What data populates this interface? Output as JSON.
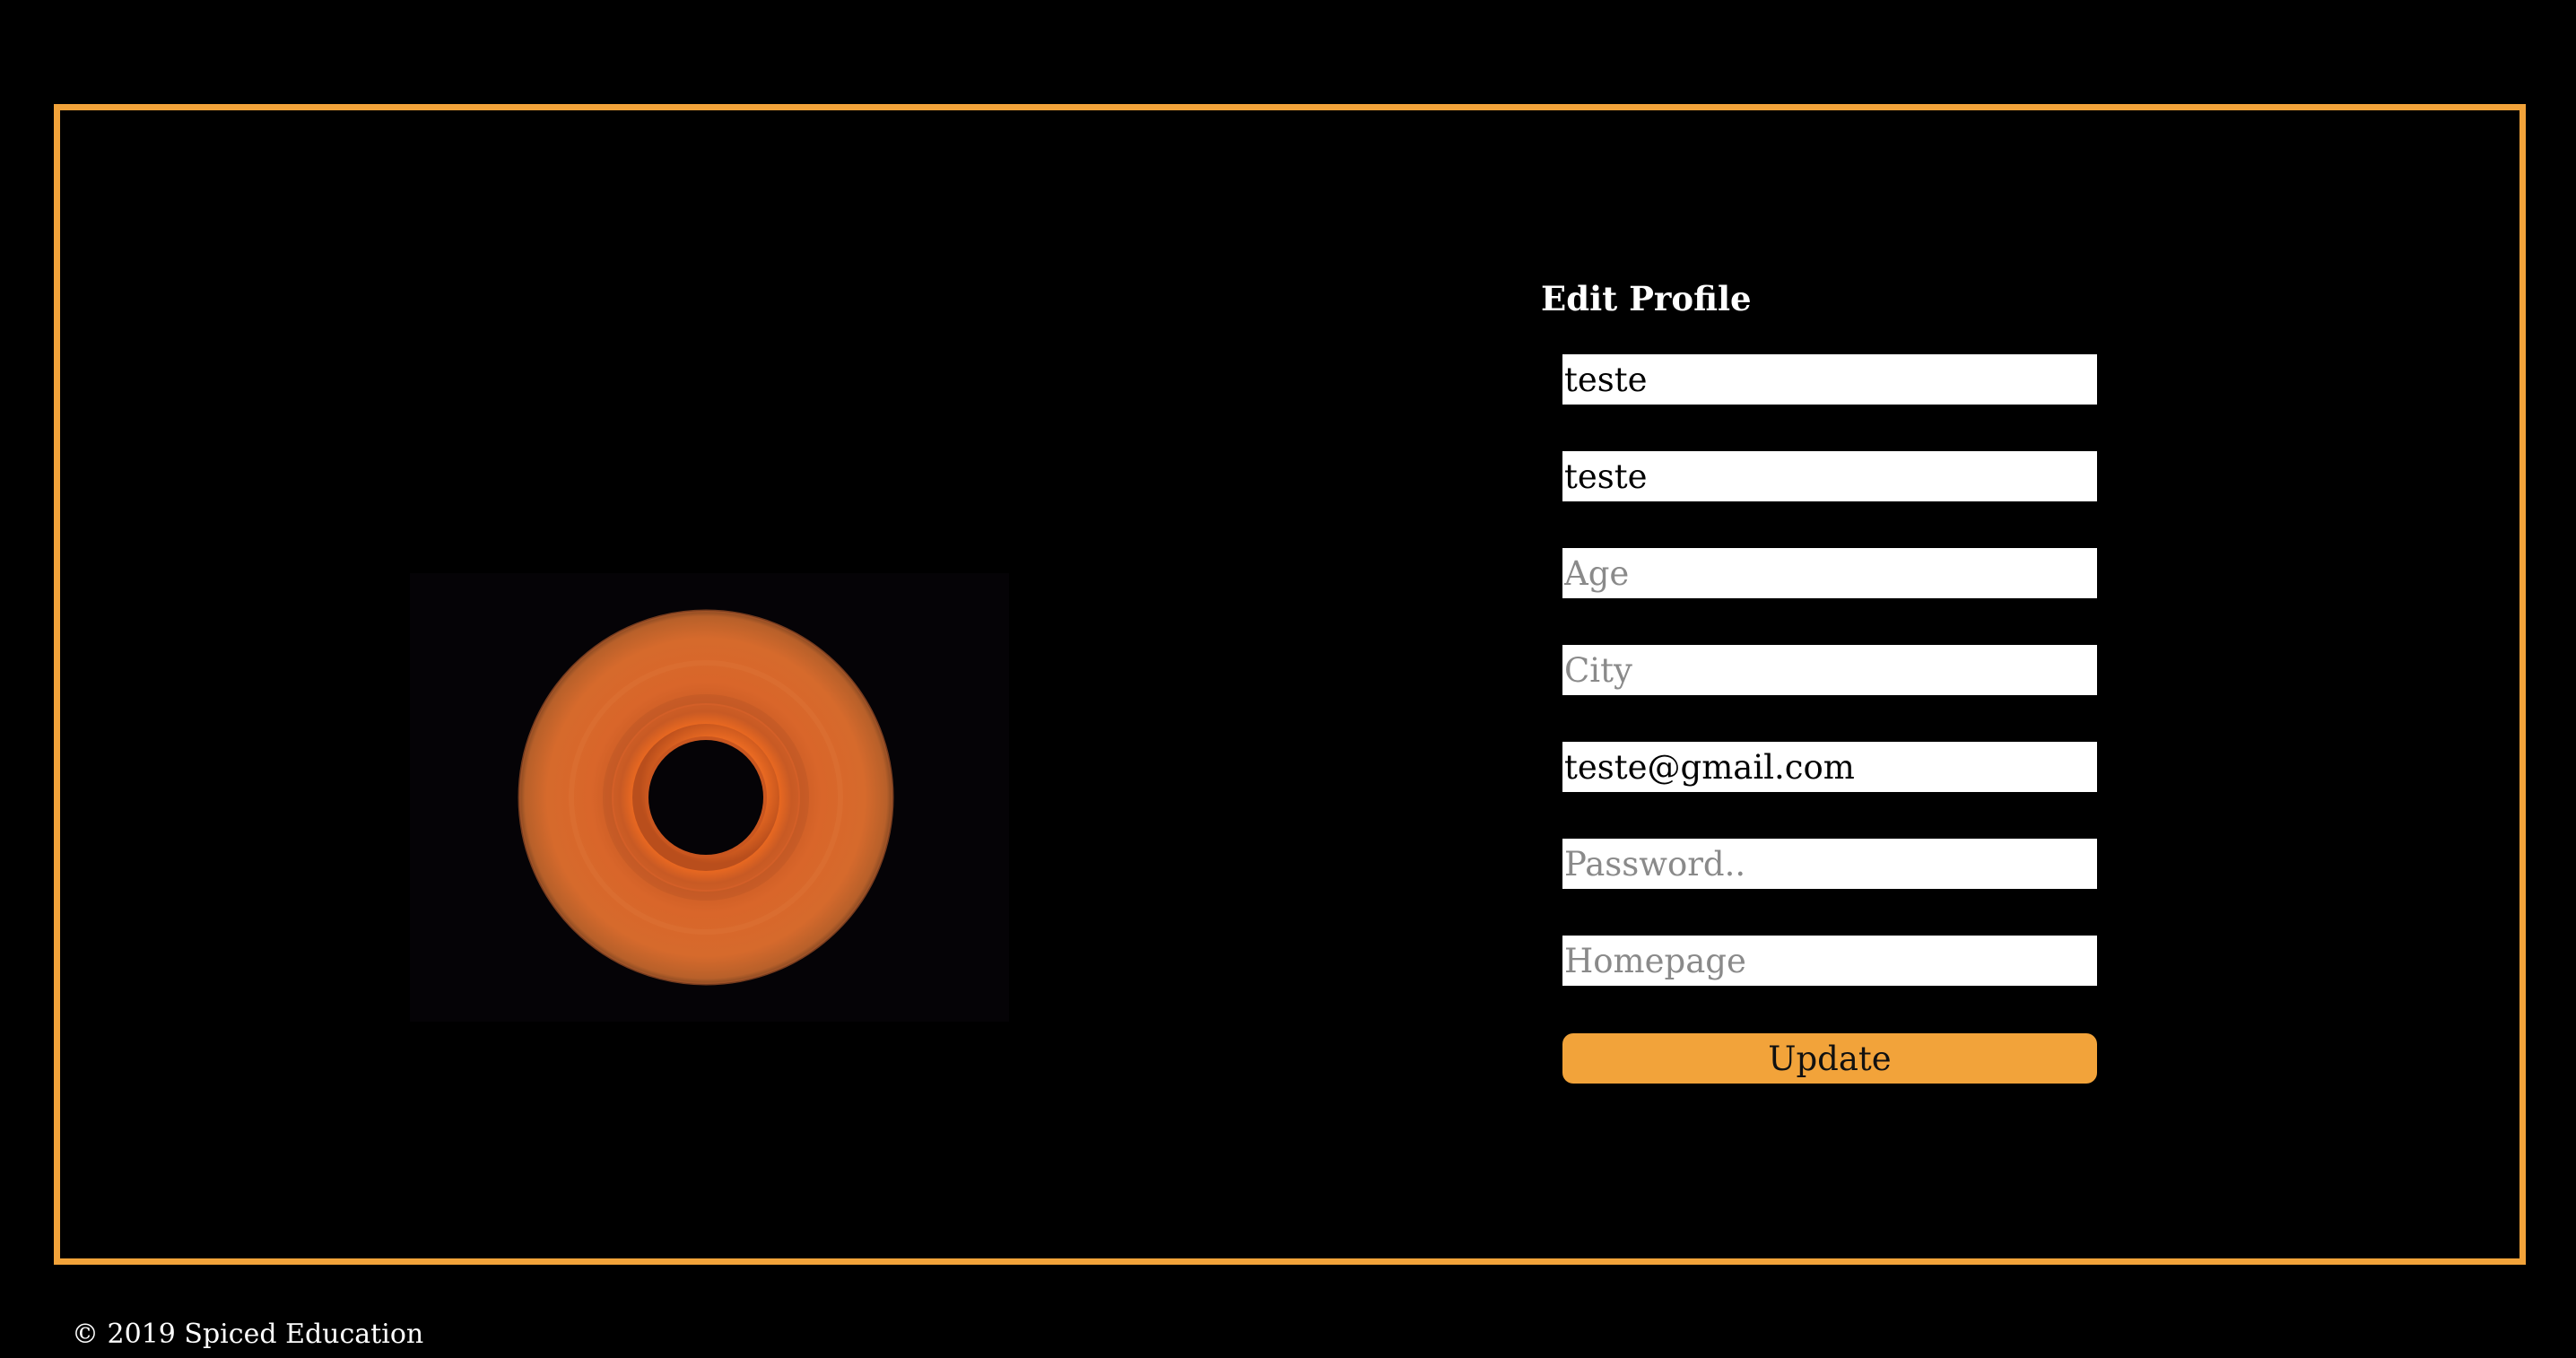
{
  "form": {
    "title": "Edit Profile",
    "first_name": {
      "value": "teste",
      "placeholder": ""
    },
    "last_name": {
      "value": "teste",
      "placeholder": ""
    },
    "age": {
      "value": "",
      "placeholder": "Age"
    },
    "city": {
      "value": "",
      "placeholder": "City"
    },
    "email": {
      "value": "teste@gmail.com",
      "placeholder": ""
    },
    "password": {
      "value": "",
      "placeholder": "Password.."
    },
    "homepage": {
      "value": "",
      "placeholder": "Homepage"
    },
    "update_label": "Update"
  },
  "footer": {
    "copyright": "© 2019 Spiced Education"
  },
  "colors": {
    "accent": "#f2a33a",
    "background": "#000000"
  }
}
